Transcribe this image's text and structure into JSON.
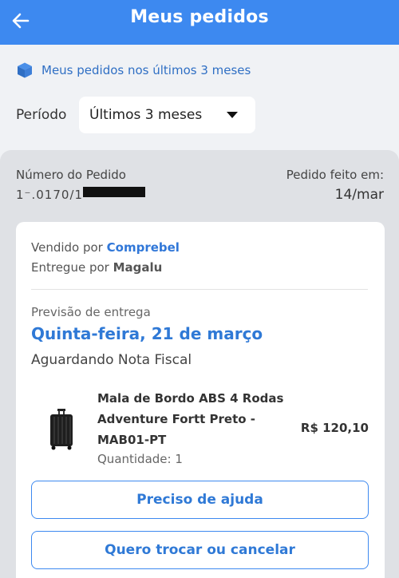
{
  "header": {
    "title": "Meus pedidos",
    "back_icon": "arrow-left-icon",
    "background_color": "#3d89f0"
  },
  "notice": {
    "icon": "box-icon",
    "text": "Meus pedidos nos últimos 3 meses"
  },
  "period": {
    "label": "Período",
    "selected": "Últimos 3 meses"
  },
  "order": {
    "number_label": "Número do Pedido",
    "number_visible": "1⁻.0170/1",
    "number_redacted": true,
    "date_label": "Pedido feito em:",
    "date": "14/mar",
    "sold_by_label": "Vendido por",
    "seller": "Comprebel",
    "delivered_by_label": "Entregue por",
    "carrier": "Magalu",
    "forecast_label": "Previsão de entrega",
    "forecast_date": "Quinta-feira, 21 de março",
    "status": "Aguardando Nota Fiscal"
  },
  "product": {
    "image_icon": "suitcase-icon",
    "name": "Mala de Bordo ABS 4 Rodas Adventure Fortt Preto - MAB01-PT",
    "quantity": "Quantidade: 1",
    "price": "R$ 120,10"
  },
  "actions": {
    "help_label": "Preciso de ajuda",
    "exchange_label": "Quero trocar ou cancelar"
  },
  "colors": {
    "accent": "#3d89f0",
    "link": "#2f79d6"
  }
}
